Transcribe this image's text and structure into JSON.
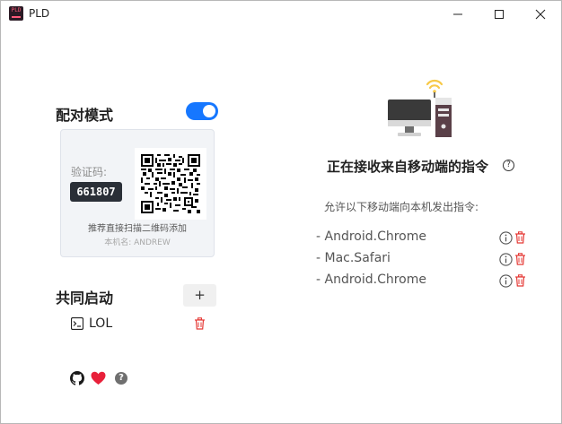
{
  "window": {
    "title": "PLD",
    "logo_text": "PLD",
    "controls": [
      "minimize-icon",
      "maximize-icon",
      "close-icon"
    ]
  },
  "pairing": {
    "title": "配对模式",
    "enabled": true,
    "code_label": "验证码:",
    "code": "661807",
    "scan_hint": "推荐直接扫描二维码添加",
    "host_name": "本机名: ANDREW"
  },
  "colocated": {
    "title": "共同启动",
    "add_label": "+",
    "items": [
      {
        "icon": "terminal-icon",
        "name": "LOL"
      }
    ]
  },
  "footer": {
    "icons": [
      "github-icon",
      "heart-icon",
      "help-icon"
    ],
    "help_label": "?"
  },
  "status": {
    "title": "正在接收来自移动端的指令",
    "help_label": "?",
    "allow_text": "允许以下移动端向本机发出指令:",
    "devices": [
      {
        "name": "- Android.Chrome"
      },
      {
        "name": "- Mac.Safari"
      },
      {
        "name": "- Android.Chrome"
      }
    ]
  },
  "colors": {
    "accent": "#1677ff",
    "danger": "#e53935",
    "code_bg": "#2a2f37",
    "heart": "#e8203a"
  }
}
